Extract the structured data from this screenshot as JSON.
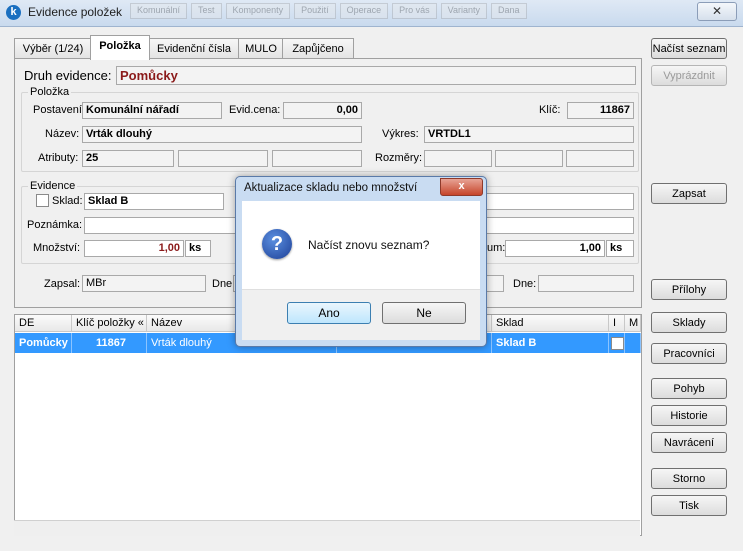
{
  "window": {
    "title": "Evidence položek",
    "app_icon": "k-logo-icon",
    "close_label": "✕",
    "background_tabs": [
      "Komunální",
      "Test",
      "Komponenty",
      "Použití",
      "Operace",
      "Pro vás",
      "Varianty",
      "Dana"
    ]
  },
  "tabs": [
    {
      "label": "Výběr (1/24)",
      "active": false
    },
    {
      "label": "Položka",
      "active": true
    },
    {
      "label": "Evidenční čísla",
      "active": false
    },
    {
      "label": "MULO",
      "active": false
    },
    {
      "label": "Zapůjčeno",
      "active": false
    }
  ],
  "header": {
    "druh_label": "Druh evidence:",
    "druh_value": "Pomůcky"
  },
  "polozka": {
    "group_label": "Položka",
    "postaveni_label": "Postavení:",
    "postaveni_value": "Komunální nářadí",
    "evid_cena_label": "Evid.cena:",
    "evid_cena_value": "0,00",
    "klic_label": "Klíč:",
    "klic_value": "11867",
    "nazev_label": "Název:",
    "nazev_value": "Vrták dlouhý",
    "vykres_label": "Výkres:",
    "vykres_value": "VRTDL1",
    "atributy_label": "Atributy:",
    "atributy_value": "25",
    "rozmery_label": "Rozměry:"
  },
  "evidence": {
    "group_label": "Evidence",
    "sklad_label": "Sklad:",
    "sklad_value": "Sklad B",
    "poznamka_label": "Poznámka:",
    "mnozstvi_label": "Množství:",
    "mnozstvi_value": "1,00",
    "mnozstvi_unit": "ks",
    "right_label_partial": "um:",
    "right_value": "1,00",
    "right_unit": "ks"
  },
  "footer_fields": {
    "zapsal_label": "Zapsal:",
    "zapsal_value": "MBr",
    "dne_label": "Dne:",
    "dne2_label": "Dne:"
  },
  "right_buttons": {
    "nacist": "Načíst seznam",
    "vyprazdnit": "Vyprázdnit",
    "zapsat": "Zapsat",
    "prilohy": "Přílohy",
    "sklady": "Sklady",
    "pracovnici": "Pracovníci",
    "pohyb": "Pohyb",
    "historie": "Historie",
    "navraceni": "Navrácení",
    "storno": "Storno",
    "tisk": "Tisk"
  },
  "grid": {
    "columns": [
      "DE",
      "Klíč položky «",
      "Název",
      "",
      "Sklad",
      "I",
      "M"
    ],
    "row": {
      "de": "Pomůcky",
      "klic": "11867",
      "nazev": "Vrták dlouhý",
      "sklad": "Sklad B"
    }
  },
  "dialog": {
    "title": "Aktualizace skladu nebo množství",
    "message": "Načíst znovu seznam?",
    "icon": "question-icon",
    "yes_label": "Ano",
    "no_label": "Ne",
    "close_label": "x"
  },
  "colors": {
    "selection": "#3399ff",
    "druh_value": "#8b1a1a",
    "dialog_frame": "#c9dcf2"
  }
}
